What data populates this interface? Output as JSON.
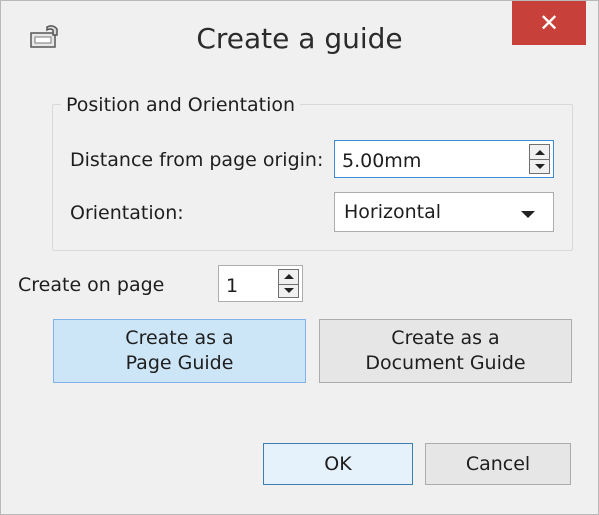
{
  "window": {
    "title": "Create a guide",
    "icon": "guides-icon",
    "close_label": "✕"
  },
  "position_group": {
    "title": "Position and Orientation",
    "distance_label": "Distance from page origin:",
    "distance_value": "5.00mm",
    "orientation_label": "Orientation:",
    "orientation_value": "Horizontal"
  },
  "page": {
    "label": "Create on page",
    "value": "1"
  },
  "buttons": {
    "page_guide": "Create as a\nPage Guide",
    "document_guide": "Create as a\nDocument Guide",
    "ok": "OK",
    "cancel": "Cancel"
  },
  "colors": {
    "close_bg": "#c7413a",
    "focus_border": "#3b8bd9",
    "hover_button_bg": "#cde6f7"
  }
}
